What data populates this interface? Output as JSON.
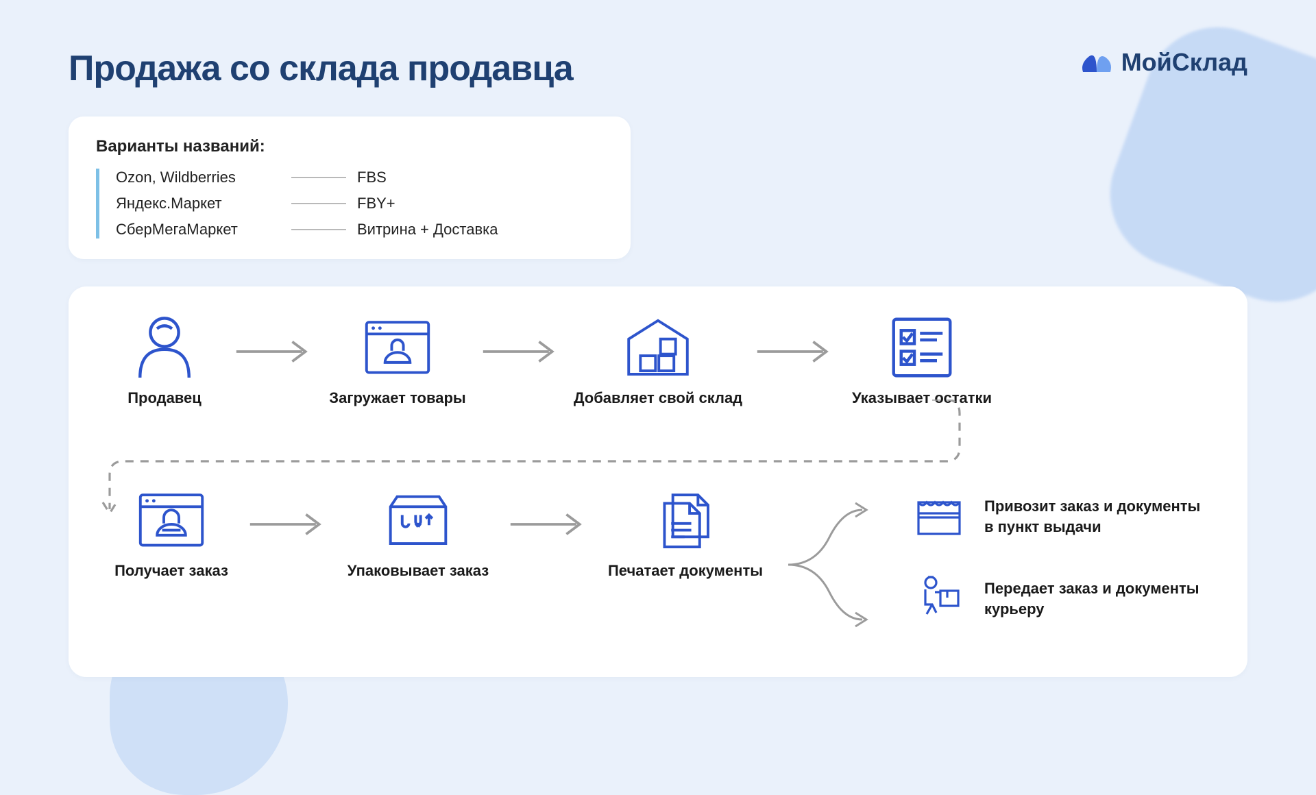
{
  "header": {
    "title": "Продажа со склада продавца",
    "brand": "МойСклад"
  },
  "variants": {
    "heading": "Варианты названий:",
    "rows": [
      {
        "left": "Ozon, Wildberries",
        "right": "FBS"
      },
      {
        "left": "Яндекс.Маркет",
        "right": "FBY+"
      },
      {
        "left": "СберМегаМаркет",
        "right": "Витрина + Доставка"
      }
    ]
  },
  "flow": {
    "row1": [
      {
        "label": "Продавец",
        "icon": "seller-person-icon"
      },
      {
        "label": "Загружает товары",
        "icon": "upload-goods-icon"
      },
      {
        "label": "Добавляет свой склад",
        "icon": "warehouse-icon"
      },
      {
        "label": "Указывает остатки",
        "icon": "checklist-icon"
      }
    ],
    "row2": [
      {
        "label": "Получает заказ",
        "icon": "order-basket-icon"
      },
      {
        "label": "Упаковывает заказ",
        "icon": "package-box-icon"
      },
      {
        "label": "Печатает документы",
        "icon": "documents-icon"
      }
    ],
    "outcomes": [
      {
        "text": "Привозит заказ и документы в пункт выдачи",
        "icon": "pickup-point-icon"
      },
      {
        "text": "Передает заказ и документы курьеру",
        "icon": "courier-icon"
      }
    ]
  }
}
